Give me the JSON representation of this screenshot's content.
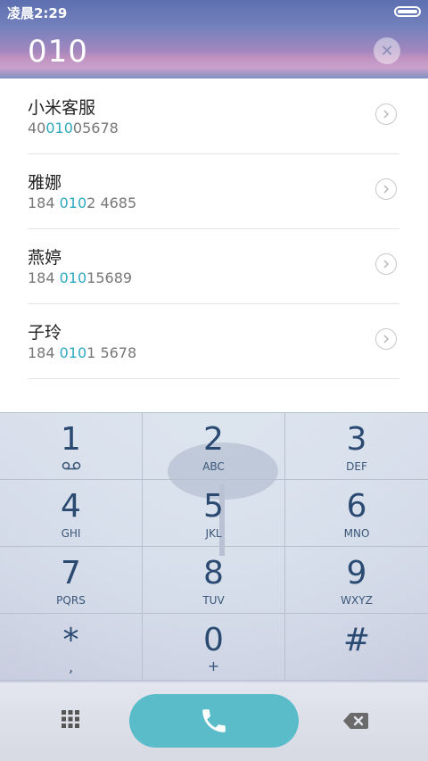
{
  "status_bar": {
    "time": "凌晨2:29"
  },
  "dialer": {
    "number": "010",
    "clear_symbol": "✕"
  },
  "contacts": [
    {
      "name": "小米客服",
      "number_pre": "40",
      "number_match": "010",
      "number_post": "05678"
    },
    {
      "name": "雅娜",
      "number_pre": "184 ",
      "number_match": "010",
      "number_post": "2 4685"
    },
    {
      "name": "燕婷",
      "number_pre": "184 ",
      "number_match": "010",
      "number_post": "15689"
    },
    {
      "name": "子玲",
      "number_pre": "184 ",
      "number_match": "010",
      "number_post": "1 5678"
    }
  ],
  "keypad": [
    {
      "digit": "1",
      "letters": "voicemail-icon"
    },
    {
      "digit": "2",
      "letters": "ABC"
    },
    {
      "digit": "3",
      "letters": "DEF"
    },
    {
      "digit": "4",
      "letters": "GHI"
    },
    {
      "digit": "5",
      "letters": "JKL"
    },
    {
      "digit": "6",
      "letters": "MNO"
    },
    {
      "digit": "7",
      "letters": "PQRS"
    },
    {
      "digit": "8",
      "letters": "TUV"
    },
    {
      "digit": "9",
      "letters": "WXYZ"
    },
    {
      "digit": "*",
      "letters": ","
    },
    {
      "digit": "0",
      "letters": "+"
    },
    {
      "digit": "#",
      "letters": ""
    }
  ],
  "icons": {
    "clear": "close-icon",
    "chevron": "chevron-right-icon",
    "grid": "dialpad-grid-icon",
    "call": "phone-icon",
    "delete": "backspace-icon"
  },
  "colors": {
    "accent": "#5bbcc9",
    "match_highlight": "#2ea8c0",
    "key_text": "#2b4a72"
  }
}
